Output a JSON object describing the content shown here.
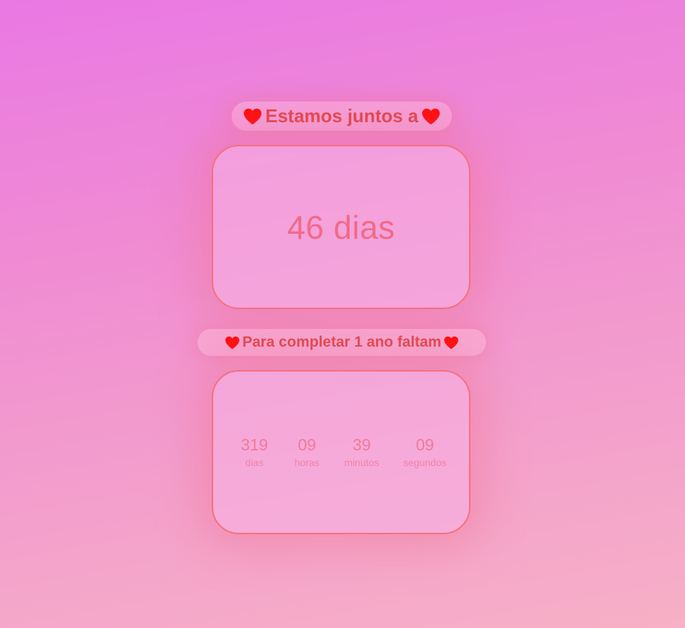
{
  "header": {
    "title": "Estamos juntos a",
    "heart_icon": "heart-icon",
    "heart_color": "#ff0a0a"
  },
  "together": {
    "value": "46 dias"
  },
  "countdown_header": {
    "title": "Para completar 1 ano faltam"
  },
  "countdown": {
    "units": [
      {
        "value": "319",
        "label": "dias"
      },
      {
        "value": "09",
        "label": "horas"
      },
      {
        "value": "39",
        "label": "minutos"
      },
      {
        "value": "09",
        "label": "segundos"
      }
    ]
  },
  "colors": {
    "accent_text": "#e0464c",
    "card_border": "#f4707e",
    "counter_text": "#f16a86"
  }
}
